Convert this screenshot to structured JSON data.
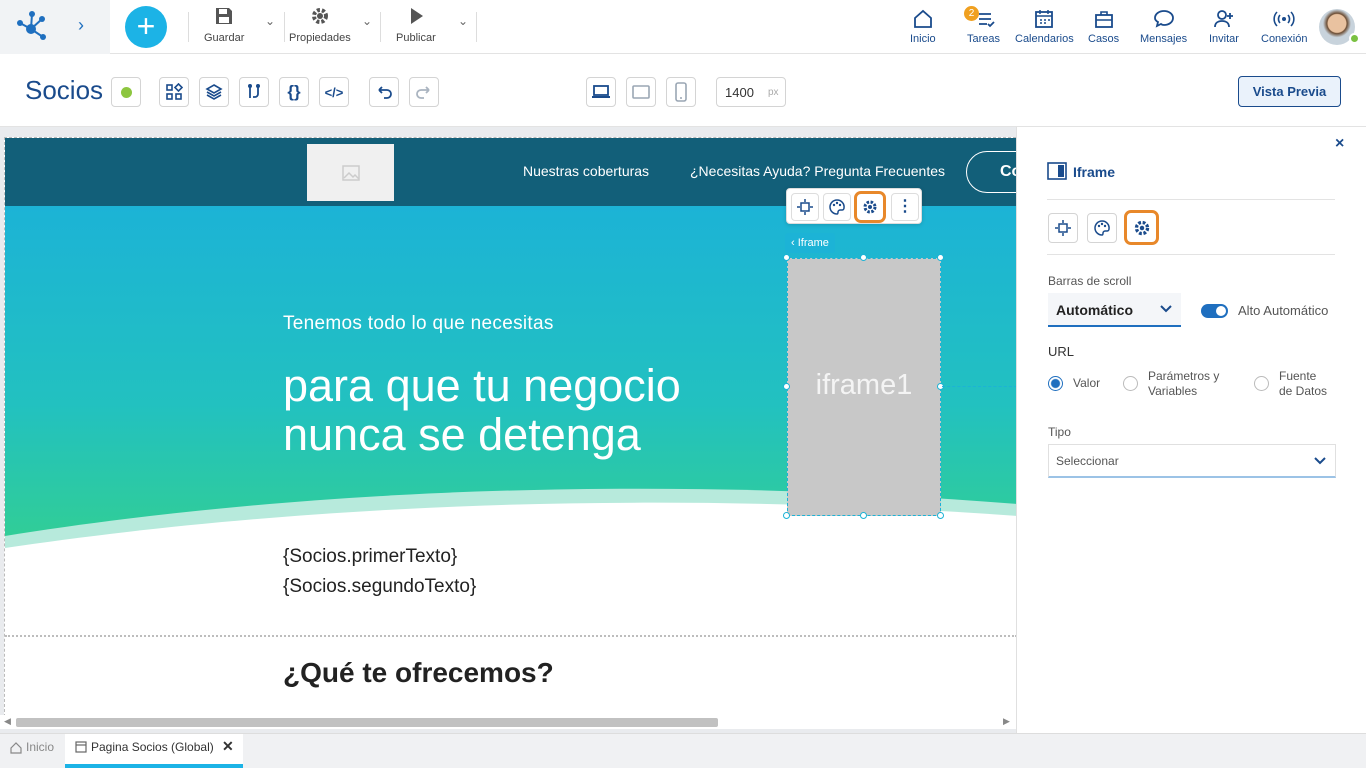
{
  "topbar": {
    "guardar": "Guardar",
    "propiedades": "Propiedades",
    "publicar": "Publicar",
    "nav": [
      {
        "label": "Inicio",
        "icon": "home-icon"
      },
      {
        "label": "Tareas",
        "icon": "tasks-icon",
        "badge": "2"
      },
      {
        "label": "Calendarios",
        "icon": "calendar-icon"
      },
      {
        "label": "Casos",
        "icon": "briefcase-icon"
      },
      {
        "label": "Mensajes",
        "icon": "chat-icon"
      },
      {
        "label": "Invitar",
        "icon": "add-user-icon"
      },
      {
        "label": "Conexión",
        "icon": "connection-icon"
      }
    ]
  },
  "toolbar": {
    "page_title": "Socios",
    "width_value": "1400",
    "width_unit": "px",
    "preview_label": "Vista Previa"
  },
  "site": {
    "nav_links": [
      "Nuestras coberturas",
      "¿Necesitas Ayuda? Pregunta Frecuentes"
    ],
    "nav_button": "Co",
    "hero_small": "Tenemos todo lo que necesitas",
    "hero_big_1": "para que tu negocio",
    "hero_big_2": "nunca se detenga",
    "text1": "{Socios.primerTexto}",
    "text2": "{Socios.segundoTexto}",
    "section_title": "¿Qué te ofrecemos?"
  },
  "iframe": {
    "tag_label": "Iframe",
    "placeholder": "iframe1"
  },
  "panel": {
    "title": "Iframe",
    "scroll_label": "Barras de scroll",
    "scroll_value": "Automático",
    "auto_height_label": "Alto Automático",
    "url_label": "URL",
    "radio_valor": "Valor",
    "radio_params_1": "Parámetros y",
    "radio_params_2": "Variables",
    "radio_fuente_1": "Fuente",
    "radio_fuente_2": "de Datos",
    "tipo_label": "Tipo",
    "tipo_value": "Seleccionar"
  },
  "tabs": {
    "inicio": "Inicio",
    "pagina": "Pagina Socios (Global)"
  },
  "colors": {
    "brand_blue": "#1f6fbf",
    "accent_orange": "#e8882a",
    "header_dark": "#125f79"
  }
}
